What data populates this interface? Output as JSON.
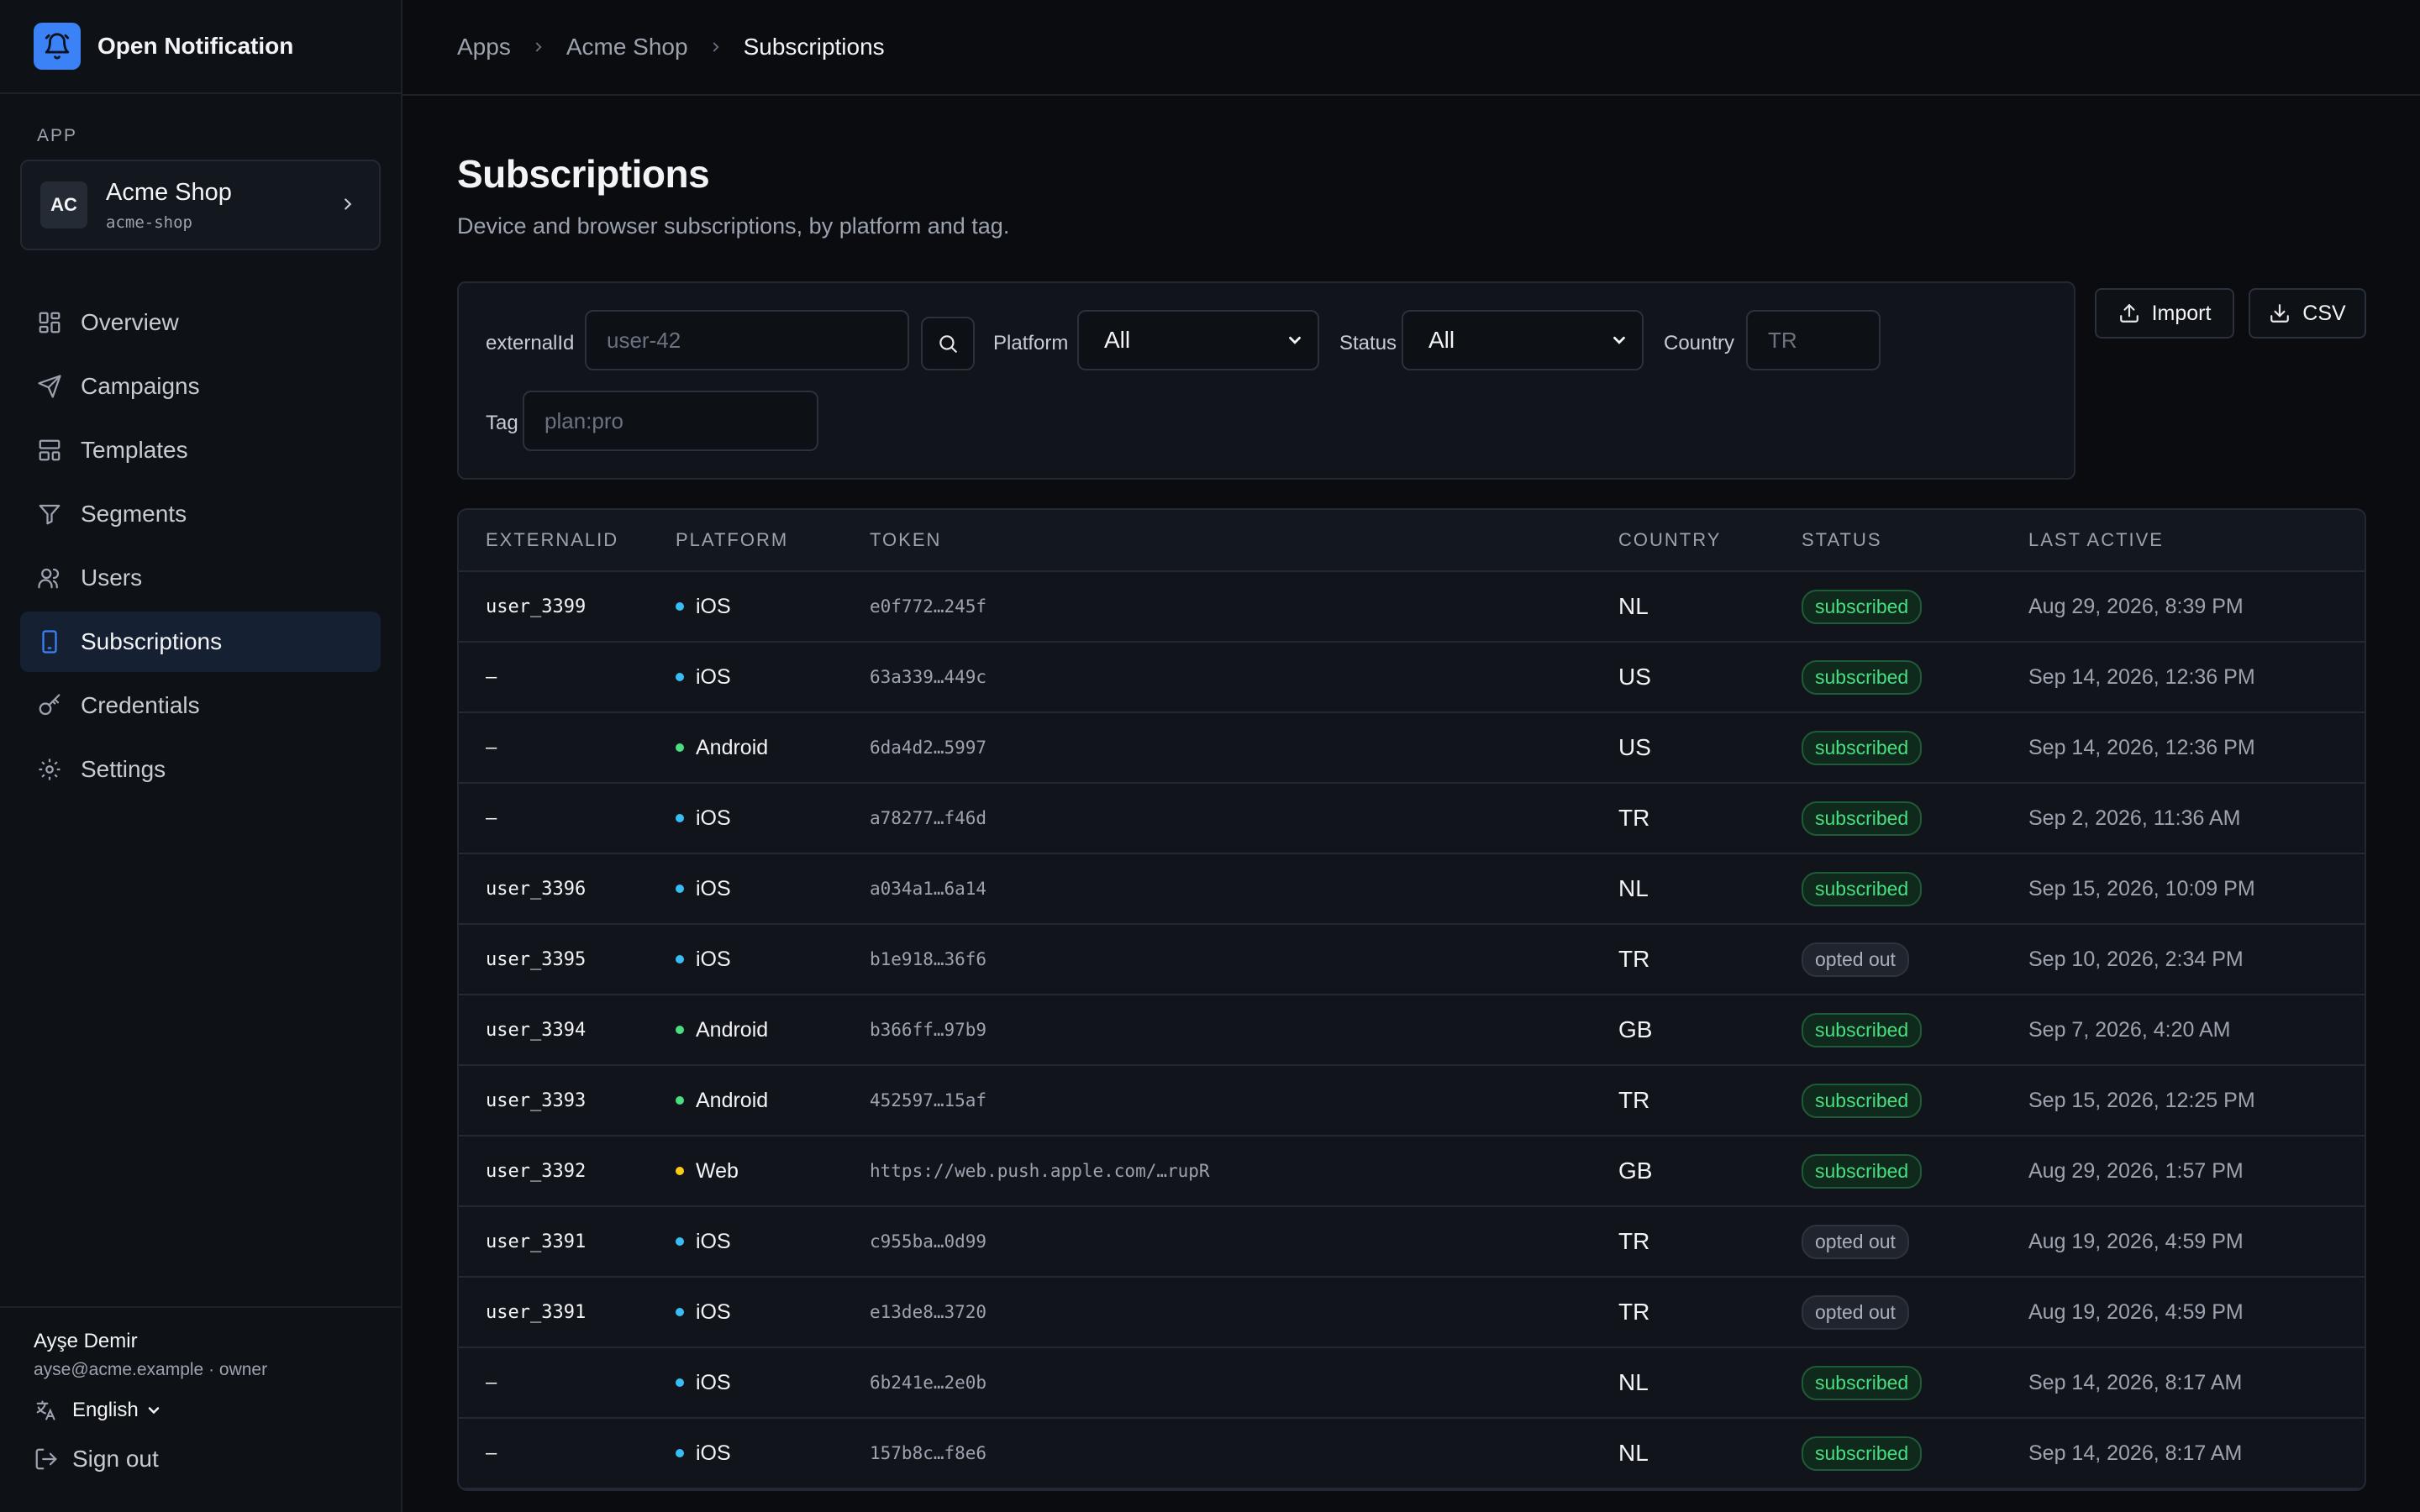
{
  "brand": {
    "name": "Open Notification"
  },
  "sidebar": {
    "section_label": "APP",
    "app": {
      "initials": "AC",
      "name": "Acme Shop",
      "slug": "acme-shop"
    },
    "nav": [
      {
        "label": "Overview",
        "icon": "grid-icon"
      },
      {
        "label": "Campaigns",
        "icon": "send-icon"
      },
      {
        "label": "Templates",
        "icon": "template-icon"
      },
      {
        "label": "Segments",
        "icon": "filter-icon"
      },
      {
        "label": "Users",
        "icon": "users-icon"
      },
      {
        "label": "Subscriptions",
        "icon": "device-icon",
        "active": true
      },
      {
        "label": "Credentials",
        "icon": "key-icon"
      },
      {
        "label": "Settings",
        "icon": "gear-icon"
      }
    ],
    "user": {
      "name": "Ayşe Demir",
      "meta": "ayse@acme.example · owner"
    },
    "language": "English",
    "sign_out": "Sign out"
  },
  "breadcrumb": [
    "Apps",
    "Acme Shop",
    "Subscriptions"
  ],
  "page": {
    "title": "Subscriptions",
    "subtitle": "Device and browser subscriptions, by platform and tag."
  },
  "filters": {
    "external_label": "externalId",
    "external_placeholder": "user-42",
    "platform_label": "Platform",
    "platform_value": "All",
    "status_label": "Status",
    "status_value": "All",
    "country_label": "Country",
    "country_placeholder": "TR",
    "tag_label": "Tag",
    "tag_placeholder": "plan:pro"
  },
  "actions": {
    "import": "Import",
    "csv": "CSV"
  },
  "colors": {
    "ios": "#38bdf8",
    "android": "#4ade80",
    "web": "#facc15"
  },
  "table": {
    "headers": [
      "EXTERNALID",
      "PLATFORM",
      "TOKEN",
      "COUNTRY",
      "STATUS",
      "LAST ACTIVE"
    ],
    "rows": [
      {
        "ext": "user_3399",
        "platform": "iOS",
        "token": "e0f772…245f",
        "country": "NL",
        "status": "subscribed",
        "last": "Aug 29, 2026, 8:39 PM"
      },
      {
        "ext": "–",
        "platform": "iOS",
        "token": "63a339…449c",
        "country": "US",
        "status": "subscribed",
        "last": "Sep 14, 2026, 12:36 PM"
      },
      {
        "ext": "–",
        "platform": "Android",
        "token": "6da4d2…5997",
        "country": "US",
        "status": "subscribed",
        "last": "Sep 14, 2026, 12:36 PM"
      },
      {
        "ext": "–",
        "platform": "iOS",
        "token": "a78277…f46d",
        "country": "TR",
        "status": "subscribed",
        "last": "Sep 2, 2026, 11:36 AM"
      },
      {
        "ext": "user_3396",
        "platform": "iOS",
        "token": "a034a1…6a14",
        "country": "NL",
        "status": "subscribed",
        "last": "Sep 15, 2026, 10:09 PM"
      },
      {
        "ext": "user_3395",
        "platform": "iOS",
        "token": "b1e918…36f6",
        "country": "TR",
        "status": "opted out",
        "last": "Sep 10, 2026, 2:34 PM"
      },
      {
        "ext": "user_3394",
        "platform": "Android",
        "token": "b366ff…97b9",
        "country": "GB",
        "status": "subscribed",
        "last": "Sep 7, 2026, 4:20 AM"
      },
      {
        "ext": "user_3393",
        "platform": "Android",
        "token": "452597…15af",
        "country": "TR",
        "status": "subscribed",
        "last": "Sep 15, 2026, 12:25 PM"
      },
      {
        "ext": "user_3392",
        "platform": "Web",
        "token": "https://web.push.apple.com/…rupR",
        "country": "GB",
        "status": "subscribed",
        "last": "Aug 29, 2026, 1:57 PM"
      },
      {
        "ext": "user_3391",
        "platform": "iOS",
        "token": "c955ba…0d99",
        "country": "TR",
        "status": "opted out",
        "last": "Aug 19, 2026, 4:59 PM"
      },
      {
        "ext": "user_3391",
        "platform": "iOS",
        "token": "e13de8…3720",
        "country": "TR",
        "status": "opted out",
        "last": "Aug 19, 2026, 4:59 PM"
      },
      {
        "ext": "–",
        "platform": "iOS",
        "token": "6b241e…2e0b",
        "country": "NL",
        "status": "subscribed",
        "last": "Sep 14, 2026, 8:17 AM"
      },
      {
        "ext": "–",
        "platform": "iOS",
        "token": "157b8c…f8e6",
        "country": "NL",
        "status": "subscribed",
        "last": "Sep 14, 2026, 8:17 AM"
      }
    ]
  }
}
